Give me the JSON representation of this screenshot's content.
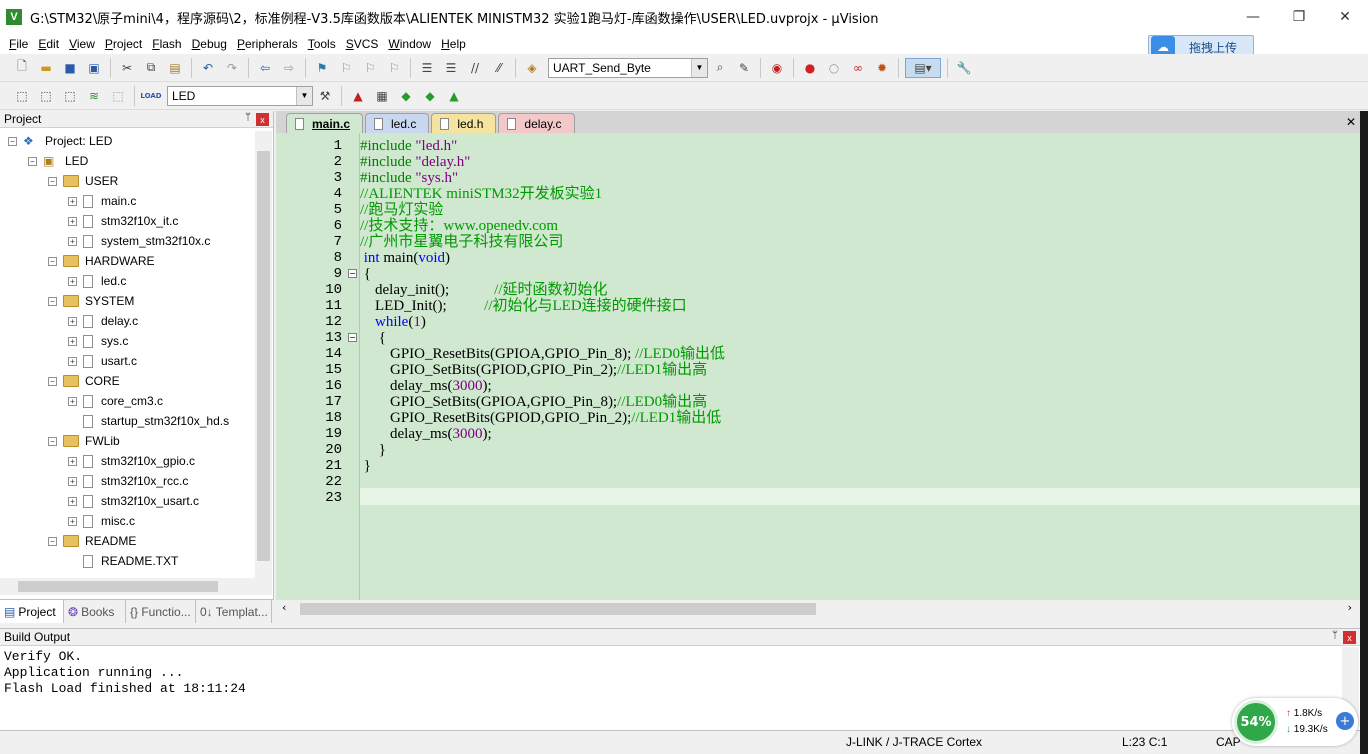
{
  "window": {
    "app_icon_text": "V",
    "title": "G:\\STM32\\原子mini\\4，程序源码\\2，标准例程-V3.5库函数版本\\ALIENTEK MINISTM32 实验1跑马灯-库函数操作\\USER\\LED.uvprojx - µVision",
    "minimize": "—",
    "maximize": "❐",
    "close": "✕"
  },
  "menu": [
    "File",
    "Edit",
    "View",
    "Project",
    "Flash",
    "Debug",
    "Peripherals",
    "Tools",
    "SVCS",
    "Window",
    "Help"
  ],
  "cloud_button": {
    "icon": "cloud-icon",
    "label": "拖拽上传"
  },
  "toolbar1": {
    "function_combo": "UART_Send_Byte"
  },
  "toolbar2": {
    "load_label": "LOAD",
    "target_combo": "LED"
  },
  "project_panel": {
    "title": "Project",
    "pin": "ᛘ",
    "close": "x",
    "tree": [
      {
        "label": "Project: LED",
        "depth": 0,
        "kind": "project",
        "exp": "−"
      },
      {
        "label": "LED",
        "depth": 1,
        "kind": "target",
        "exp": "−"
      },
      {
        "label": "USER",
        "depth": 2,
        "kind": "folder",
        "exp": "−"
      },
      {
        "label": "main.c",
        "depth": 3,
        "kind": "file",
        "exp": "+"
      },
      {
        "label": "stm32f10x_it.c",
        "depth": 3,
        "kind": "file",
        "exp": "+"
      },
      {
        "label": "system_stm32f10x.c",
        "depth": 3,
        "kind": "file",
        "exp": "+"
      },
      {
        "label": "HARDWARE",
        "depth": 2,
        "kind": "folder",
        "exp": "−"
      },
      {
        "label": "led.c",
        "depth": 3,
        "kind": "file",
        "exp": "+"
      },
      {
        "label": "SYSTEM",
        "depth": 2,
        "kind": "folder",
        "exp": "−"
      },
      {
        "label": "delay.c",
        "depth": 3,
        "kind": "file",
        "exp": "+"
      },
      {
        "label": "sys.c",
        "depth": 3,
        "kind": "file",
        "exp": "+"
      },
      {
        "label": "usart.c",
        "depth": 3,
        "kind": "file",
        "exp": "+"
      },
      {
        "label": "CORE",
        "depth": 2,
        "kind": "folder",
        "exp": "−"
      },
      {
        "label": "core_cm3.c",
        "depth": 3,
        "kind": "file",
        "exp": "+"
      },
      {
        "label": "startup_stm32f10x_hd.s",
        "depth": 3,
        "kind": "file",
        "exp": ""
      },
      {
        "label": "FWLib",
        "depth": 2,
        "kind": "folder",
        "exp": "−"
      },
      {
        "label": "stm32f10x_gpio.c",
        "depth": 3,
        "kind": "file",
        "exp": "+"
      },
      {
        "label": "stm32f10x_rcc.c",
        "depth": 3,
        "kind": "file",
        "exp": "+"
      },
      {
        "label": "stm32f10x_usart.c",
        "depth": 3,
        "kind": "file",
        "exp": "+"
      },
      {
        "label": "misc.c",
        "depth": 3,
        "kind": "file",
        "exp": "+"
      },
      {
        "label": "README",
        "depth": 2,
        "kind": "folder",
        "exp": "−"
      },
      {
        "label": "README.TXT",
        "depth": 3,
        "kind": "file",
        "exp": ""
      }
    ],
    "bottom_tabs": [
      "Project",
      "Books",
      "{} Functio...",
      "0↓ Templat..."
    ]
  },
  "editor": {
    "tabs": [
      "main.c",
      "led.c",
      "led.h",
      "delay.c"
    ],
    "active_tab": "main.c",
    "close": "✕",
    "lines": [
      [
        [
          "#include ",
          "pre"
        ],
        [
          "\"led.h\"",
          "str"
        ]
      ],
      [
        [
          "#include ",
          "pre"
        ],
        [
          "\"delay.h\"",
          "str"
        ]
      ],
      [
        [
          "#include ",
          "pre"
        ],
        [
          "\"sys.h\"",
          "str"
        ]
      ],
      [
        [
          "//ALIENTEK miniSTM32开发板实验1",
          "cm"
        ]
      ],
      [
        [
          "//跑马灯实验",
          "cm"
        ]
      ],
      [
        [
          "//技术支持：www.openedv.com",
          "cm"
        ]
      ],
      [
        [
          "//广州市星翼电子科技有限公司",
          "cm"
        ]
      ],
      [
        [
          " ",
          ""
        ],
        [
          "int",
          "kw"
        ],
        [
          " main(",
          ""
        ],
        [
          "void",
          "kw"
        ],
        [
          ")",
          ""
        ]
      ],
      [
        [
          " {",
          ""
        ]
      ],
      [
        [
          "    delay_init();            ",
          ""
        ],
        [
          "//延时函数初始化",
          "cm"
        ]
      ],
      [
        [
          "    LED_Init();          ",
          ""
        ],
        [
          "//初始化与LED连接的硬件接口",
          "cm"
        ]
      ],
      [
        [
          "    ",
          ""
        ],
        [
          "while",
          "kw"
        ],
        [
          "(",
          ""
        ],
        [
          "1",
          "num"
        ],
        [
          ")",
          ""
        ]
      ],
      [
        [
          "     {",
          ""
        ]
      ],
      [
        [
          "        GPIO_ResetBits(GPIOA,GPIO_Pin_8); ",
          ""
        ],
        [
          "//LED0输出低",
          "cm"
        ]
      ],
      [
        [
          "        GPIO_SetBits(GPIOD,GPIO_Pin_2);",
          ""
        ],
        [
          "//LED1输出高",
          "cm"
        ]
      ],
      [
        [
          "        delay_ms(",
          ""
        ],
        [
          "3000",
          "num"
        ],
        [
          ");",
          ""
        ]
      ],
      [
        [
          "        GPIO_SetBits(GPIOA,GPIO_Pin_8);",
          ""
        ],
        [
          "//LED0输出高",
          "cm"
        ]
      ],
      [
        [
          "        GPIO_ResetBits(GPIOD,GPIO_Pin_2);",
          ""
        ],
        [
          "//LED1输出低",
          "cm"
        ]
      ],
      [
        [
          "        delay_ms(",
          ""
        ],
        [
          "3000",
          "num"
        ],
        [
          ");",
          ""
        ]
      ],
      [
        [
          "     }",
          ""
        ]
      ],
      [
        [
          " }",
          ""
        ]
      ],
      [
        [
          "",
          ""
        ]
      ],
      [
        [
          "",
          ""
        ]
      ]
    ],
    "fold_markers": {
      "9": "−",
      "13": "−"
    }
  },
  "build_output": {
    "title": "Build Output",
    "lines": [
      "Verify OK.",
      "Application running ...",
      "Flash Load finished at 18:11:24"
    ]
  },
  "status": {
    "debugger": "J-LINK / J-TRACE Cortex",
    "cursor": "L:23 C:1",
    "caps": "CAP"
  },
  "speed_widget": {
    "percent": "54%",
    "upload": "1.8K/s",
    "download": "19.3K/s",
    "plus": "+"
  },
  "colors": {
    "editor_bg": "#cfe8cf",
    "comment": "#009900",
    "keyword": "#0000ff",
    "string": "#800080"
  }
}
